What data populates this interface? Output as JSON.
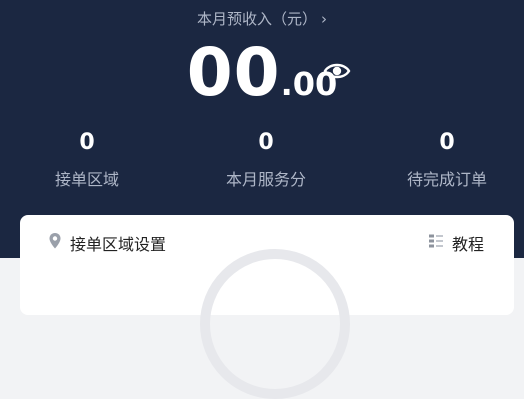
{
  "header": {
    "income_title": "本月预收入（元）",
    "chevron": "›",
    "amount_int": "00",
    "amount_dec": ".00",
    "eye_icon": "eye-icon"
  },
  "stats": [
    {
      "value": "0",
      "label": "接单区域"
    },
    {
      "value": "0",
      "label": "本月服务分"
    },
    {
      "value": "0",
      "label": "待完成订单"
    }
  ],
  "card": {
    "title": "接单区域设置",
    "tutorial": "教程",
    "pin_icon": "location-pin-icon",
    "doc_icon": "list-icon"
  },
  "colors": {
    "hero_bg": "#1b2741",
    "muted_text": "#aeb6c7"
  }
}
